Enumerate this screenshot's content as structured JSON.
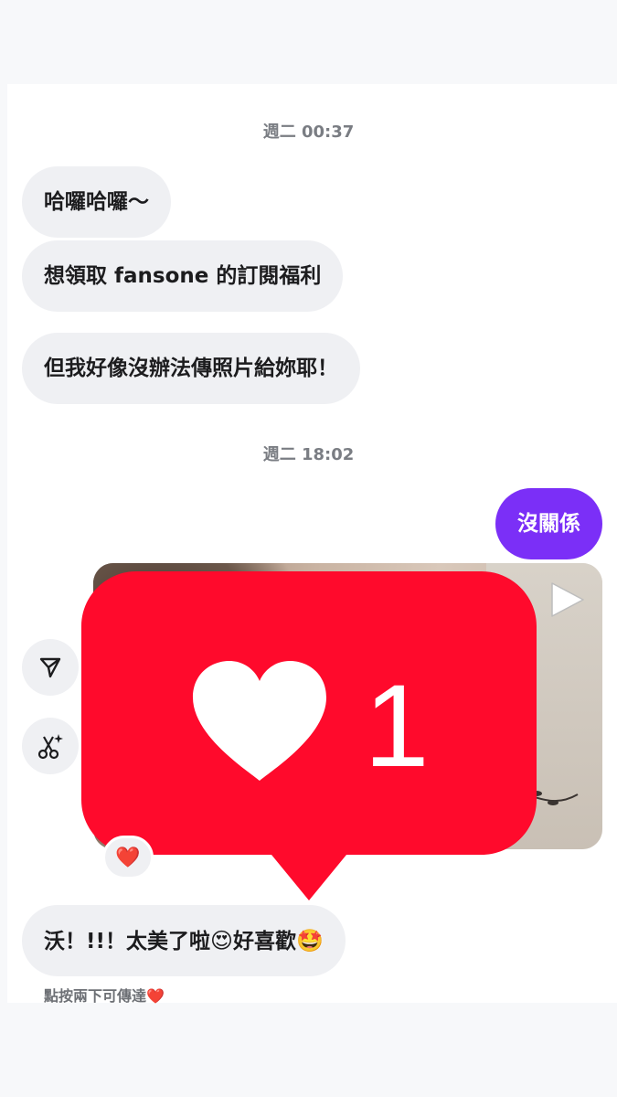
{
  "chat": {
    "timestamp1": "週二 00:37",
    "msg1": "哈囉哈囉～",
    "msg2": "想領取 fansone 的訂閱福利",
    "msg3": "但我好像沒辦法傳照片給妳耶！",
    "timestamp2": "週二 18:02",
    "reply": "沒關係",
    "like_count": "1",
    "reaction_emoji": "❤️",
    "msg4_text": "沃！!!！太美了啦",
    "msg4_emoji1": "😍",
    "msg4_text2": "好喜歡",
    "msg4_emoji2": "🤩",
    "hint_text": "點按兩下可傳達",
    "hint_emoji": "❤️"
  },
  "colors": {
    "accent": "#7b2ff7",
    "like_red": "#ff0a2c",
    "bubble_bg": "#eff0f3"
  },
  "icons": [
    "share-icon",
    "scissors-sparkle-icon",
    "play-icon",
    "heart-icon"
  ]
}
